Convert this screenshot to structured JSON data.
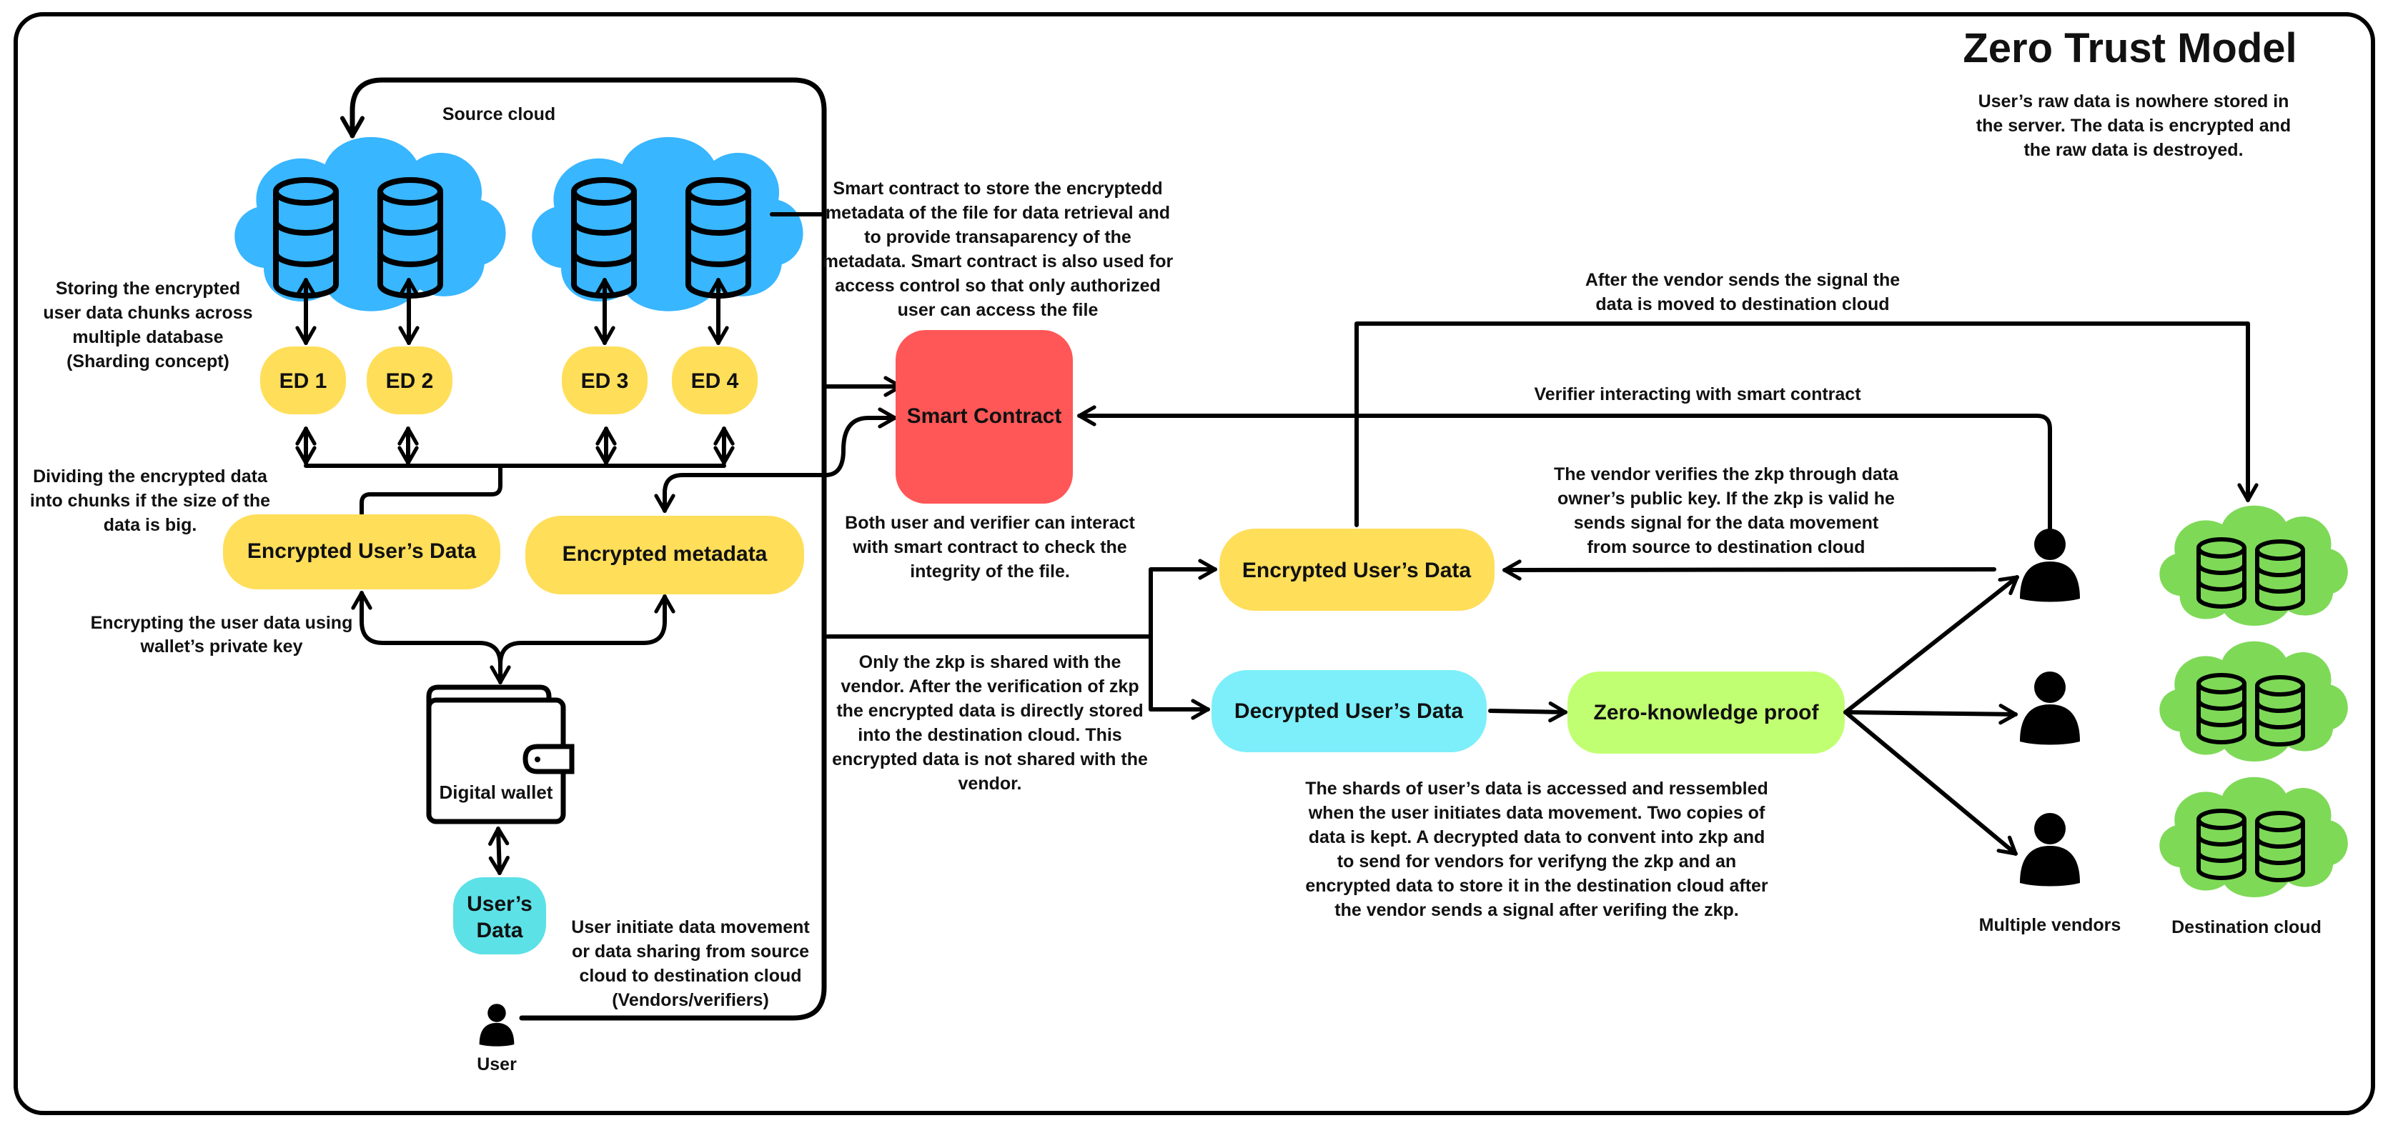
{
  "title": "Zero Trust Model",
  "subtitle_lines": [
    "User’s raw data is nowhere stored in",
    "the server. The data is encrypted and",
    "the raw data is destroyed."
  ],
  "colors": {
    "source_cloud": "#38b6ff",
    "destination_cloud": "#7ed957",
    "yellow_box": "#ffde59",
    "smart_contract": "#ff5757",
    "users_data": "#5ce1e6",
    "decrypted_box": "#7ceffa",
    "zkp_box": "#c1ff72"
  },
  "source_cloud": {
    "label": "Source cloud",
    "shards": [
      "ED 1",
      "ED 2",
      "ED 3",
      "ED 4"
    ]
  },
  "notes": {
    "sharding": [
      "Storing the encrypted",
      "user data chunks across",
      "multiple database",
      "(Sharding concept)"
    ],
    "dividing": [
      "Dividing the encrypted data",
      "into chunks if the size of the",
      "data is big."
    ],
    "encrypting": [
      "Encrypting the user data using",
      "wallet’s private key"
    ],
    "smart_contract_desc": [
      "Smart contract to store the encryptedd",
      "metadata of the file for data retrieval and",
      "to provide transaparency of the",
      "metadata. Smart contract is also used for",
      "access control so that only authorized",
      "user can access the file"
    ],
    "integrity": [
      "Both user and verifier can interact",
      "with smart contract to check the",
      "integrity of the file."
    ],
    "zkp_shared": [
      "Only the zkp is shared with the",
      "vendor. After the verification of zkp",
      "the encrypted data is directly stored",
      "into the destination cloud. This",
      "encrypted data is not shared with the",
      "vendor."
    ],
    "user_initiate": [
      "User initiate data movement",
      "or data sharing from source",
      "cloud to destination cloud",
      "(Vendors/verifiers)"
    ],
    "after_signal": [
      "After the vendor sends the signal the",
      "data is moved to destination cloud"
    ],
    "verifier_interacting": "Verifier interacting with smart contract",
    "vendor_verifies": [
      "The vendor verifies the zkp through data",
      "owner’s public key. If  the zkp is valid he",
      "sends signal for the data movement",
      "from source to destination cloud"
    ],
    "shards_accessed": [
      "The shards of user’s data is accessed and ressembled",
      "when the user initiates data movement. Two copies of",
      "data is kept. A decrypted data to convent into zkp and",
      "to send for vendors for verifyng the zkp and an",
      "encrypted data to store it in the destination cloud after",
      "the vendor sends a signal after verifing the zkp."
    ]
  },
  "nodes": {
    "encrypted_users_data_left": "Encrypted User’s Data",
    "encrypted_metadata": "Encrypted metadata",
    "digital_wallet": "Digital wallet",
    "users_data": [
      "User’s",
      "Data"
    ],
    "user": "User",
    "smart_contract": "Smart Contract",
    "encrypted_users_data_right": "Encrypted User’s Data",
    "decrypted_users_data": "Decrypted User’s Data",
    "zero_knowledge_proof": "Zero-knowledge proof",
    "multiple_vendors": "Multiple vendors",
    "destination_cloud": "Destination cloud"
  }
}
